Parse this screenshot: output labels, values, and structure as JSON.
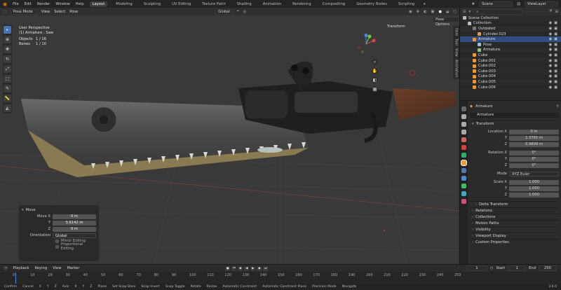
{
  "topbar": {
    "menus": [
      "File",
      "Edit",
      "Render",
      "Window",
      "Help"
    ],
    "workspaces": [
      "Layout",
      "Modeling",
      "Sculpting",
      "UV Editing",
      "Texture Paint",
      "Shading",
      "Animation",
      "Rendering",
      "Compositing",
      "Geometry Nodes",
      "Scripting"
    ],
    "active_workspace": "Layout",
    "scene": "Scene",
    "view_layer": "ViewLayer"
  },
  "viewport": {
    "mode": "Pose Mode",
    "menus": [
      "View",
      "Select",
      "Pose"
    ],
    "orientation": "Global",
    "pose_options": "Pose Options",
    "transform_label": "Transform",
    "info": {
      "view": "User Perspective",
      "object": "(1) Armature : Saw",
      "objects_label": "Objects",
      "objects_value": "1 / 16",
      "bones_label": "Bones",
      "bones_value": "1 / 10"
    },
    "side_tabs": [
      "Item",
      "Tool",
      "View",
      "Animation"
    ]
  },
  "redo_panel": {
    "title": "Move",
    "move_x_label": "Move X",
    "move_x": "0 m",
    "y_label": "Y",
    "y": "5.6142 m",
    "z_label": "Z",
    "z": "0 m",
    "orientation_label": "Orientation",
    "orientation": "Global",
    "mirror_editing": "Mirror Editing",
    "proportional_editing": "Proportional Editing"
  },
  "outliner": {
    "search_placeholder": "",
    "items": [
      {
        "label": "Scene Collection",
        "indent": 0,
        "color": "#bdbdbd"
      },
      {
        "label": "Collection",
        "indent": 1,
        "color": "#bdbdbd"
      },
      {
        "label": "Outdated",
        "indent": 2,
        "color": "#777777"
      },
      {
        "label": "Cylinder.023",
        "indent": 3,
        "color": "#e59a3c"
      },
      {
        "label": "Armature",
        "indent": 2,
        "color": "#e59a3c"
      },
      {
        "label": "Pose",
        "indent": 3,
        "color": "#9fbde0"
      },
      {
        "label": "Armature",
        "indent": 3,
        "color": "#8fc37a"
      },
      {
        "label": "Cube",
        "indent": 2,
        "color": "#e59a3c"
      },
      {
        "label": "Cube.001",
        "indent": 2,
        "color": "#e59a3c"
      },
      {
        "label": "Cube.002",
        "indent": 2,
        "color": "#e59a3c"
      },
      {
        "label": "Cube.003",
        "indent": 2,
        "color": "#e59a3c"
      },
      {
        "label": "Cube.004",
        "indent": 2,
        "color": "#e59a3c"
      },
      {
        "label": "Cube.005",
        "indent": 2,
        "color": "#e59a3c"
      },
      {
        "label": "Cube.006",
        "indent": 2,
        "color": "#e59a3c"
      }
    ]
  },
  "properties": {
    "object_name": "Armature",
    "datablock": "Armature",
    "transform_title": "Transform",
    "location_x_label": "Location X",
    "location_x": "0 m",
    "location_y_label": "Y",
    "location_y": "1.3765 m",
    "location_z_label": "Z",
    "location_z": "0.9809 m",
    "rotation_x_label": "Rotation X",
    "rotation_x": "0°",
    "rotation_y_label": "Y",
    "rotation_y": "0°",
    "rotation_z_label": "Z",
    "rotation_z": "0°",
    "mode_label": "Mode",
    "mode": "XYZ Euler",
    "scale_x_label": "Scale X",
    "scale_x": "1.000",
    "scale_y_label": "Y",
    "scale_y": "1.000",
    "scale_z_label": "Z",
    "scale_z": "1.000",
    "panels": [
      "Delta Transform",
      "Relations",
      "Collections",
      "Motion Paths",
      "Visibility",
      "Viewport Display",
      "Custom Properties"
    ]
  },
  "timeline": {
    "menus": [
      "Playback",
      "Keying",
      "View",
      "Marker"
    ],
    "current_frame": "1",
    "start_label": "Start",
    "start": "1",
    "end_label": "End",
    "end": "250",
    "ticks": [
      "0",
      "10",
      "20",
      "30",
      "40",
      "50",
      "60",
      "70",
      "80",
      "90",
      "100",
      "110",
      "120",
      "130",
      "140",
      "150",
      "160",
      "170",
      "180",
      "190",
      "200",
      "210",
      "220",
      "230",
      "240",
      "250"
    ]
  },
  "statusbar": {
    "items": [
      "Confirm",
      "Cancel",
      "X",
      "Y",
      "Z",
      "Axis",
      "X",
      "Y",
      "Z",
      "Plane",
      "Set Snap Base",
      "Snap Invert",
      "Snap Toggle",
      "Rotate",
      "Resize",
      "Automatic Constraint",
      "Automatic Constraint Plane",
      "Precision Mode",
      "Navigate"
    ],
    "version": "3.6.0"
  }
}
